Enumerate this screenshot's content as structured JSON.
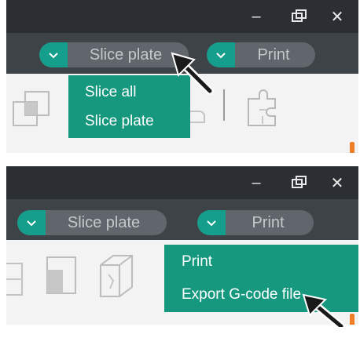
{
  "colors": {
    "accent": "#169e8c",
    "titlebar": "#2b2e32",
    "toolbar": "#3e4347",
    "button": "#60666b",
    "menu": "#16987f"
  },
  "panel1": {
    "window": {
      "minimize": "–",
      "restore": "⧉",
      "close": "✕"
    },
    "slice_label": "Slice plate",
    "print_label": "Print",
    "menu": [
      "Slice all",
      "Slice plate"
    ]
  },
  "panel2": {
    "window": {
      "minimize": "–",
      "restore": "⧉",
      "close": "✕"
    },
    "slice_label": "Slice plate",
    "print_label": "Print",
    "menu": [
      "Print",
      "Export G-code file"
    ]
  },
  "icons": [
    "chevron-down-icon",
    "arrange-icon",
    "cut-icon",
    "assembly-icon",
    "box-icon",
    "pointer-arrow-icon"
  ]
}
